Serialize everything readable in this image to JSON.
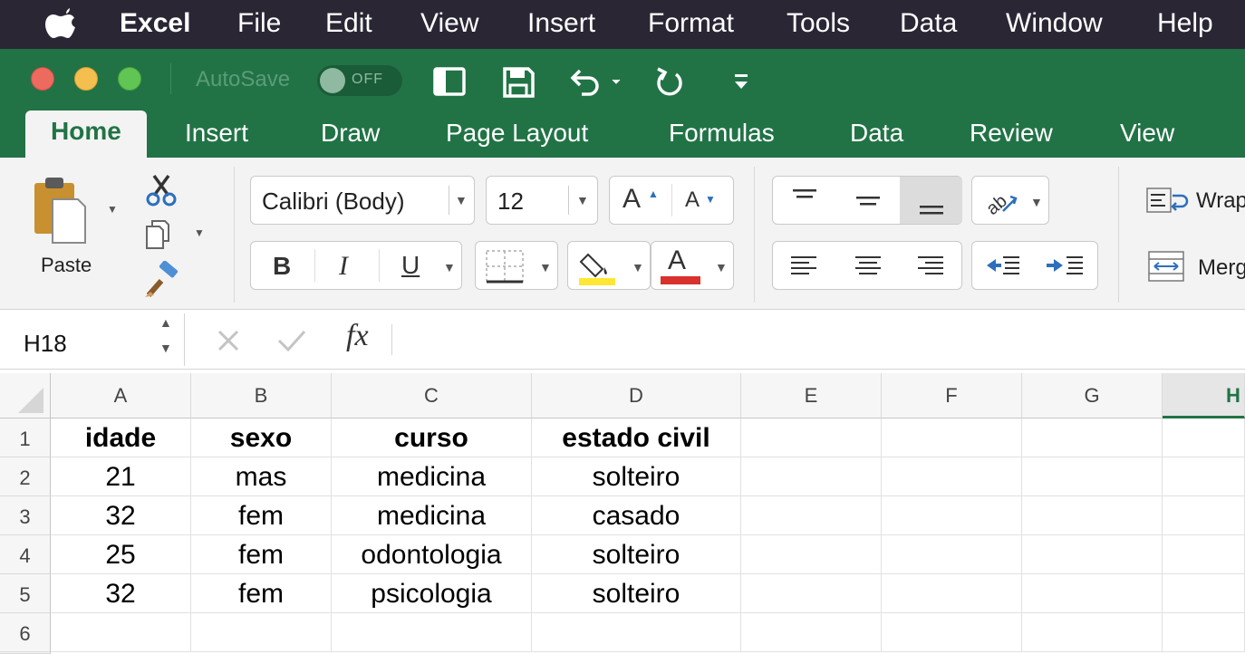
{
  "menubar": {
    "app": "Excel",
    "items": [
      "File",
      "Edit",
      "View",
      "Insert",
      "Format",
      "Tools",
      "Data",
      "Window",
      "Help"
    ]
  },
  "titlebar": {
    "autosave_label": "AutoSave",
    "autosave_state": "OFF",
    "traffic_colors": [
      "#ed6a5e",
      "#f5bf4f",
      "#61c554"
    ]
  },
  "ribbon": {
    "tabs": [
      "Home",
      "Insert",
      "Draw",
      "Page Layout",
      "Formulas",
      "Data",
      "Review",
      "View"
    ],
    "active_tab": "Home",
    "paste_label": "Paste",
    "font_name": "Calibri (Body)",
    "font_size": "12",
    "bold": "B",
    "italic": "I",
    "underline": "U",
    "font_color_glyph": "A",
    "grow_font": "A",
    "shrink_font": "A",
    "wrap_label": "Wrap",
    "merge_label": "Merg",
    "highlight_color": "#ffe733",
    "font_color": "#d9312b"
  },
  "formula_bar": {
    "name_box": "H18",
    "fx": "fx",
    "value": ""
  },
  "sheet": {
    "columns": [
      "A",
      "B",
      "C",
      "D",
      "E",
      "F",
      "G",
      "H"
    ],
    "row_numbers": [
      "1",
      "2",
      "3",
      "4",
      "5",
      "6"
    ],
    "rows": [
      [
        "idade",
        "sexo",
        "curso",
        "estado civil"
      ],
      [
        "21",
        "mas",
        "medicina",
        "solteiro"
      ],
      [
        "32",
        "fem",
        "medicina",
        "casado"
      ],
      [
        "25",
        "fem",
        "odontologia",
        "solteiro"
      ],
      [
        "32",
        "fem",
        "psicologia",
        "solteiro"
      ],
      [
        "",
        "",
        "",
        ""
      ]
    ]
  },
  "colors": {
    "excel_green": "#217346",
    "menubar_bg": "#2a2634"
  }
}
